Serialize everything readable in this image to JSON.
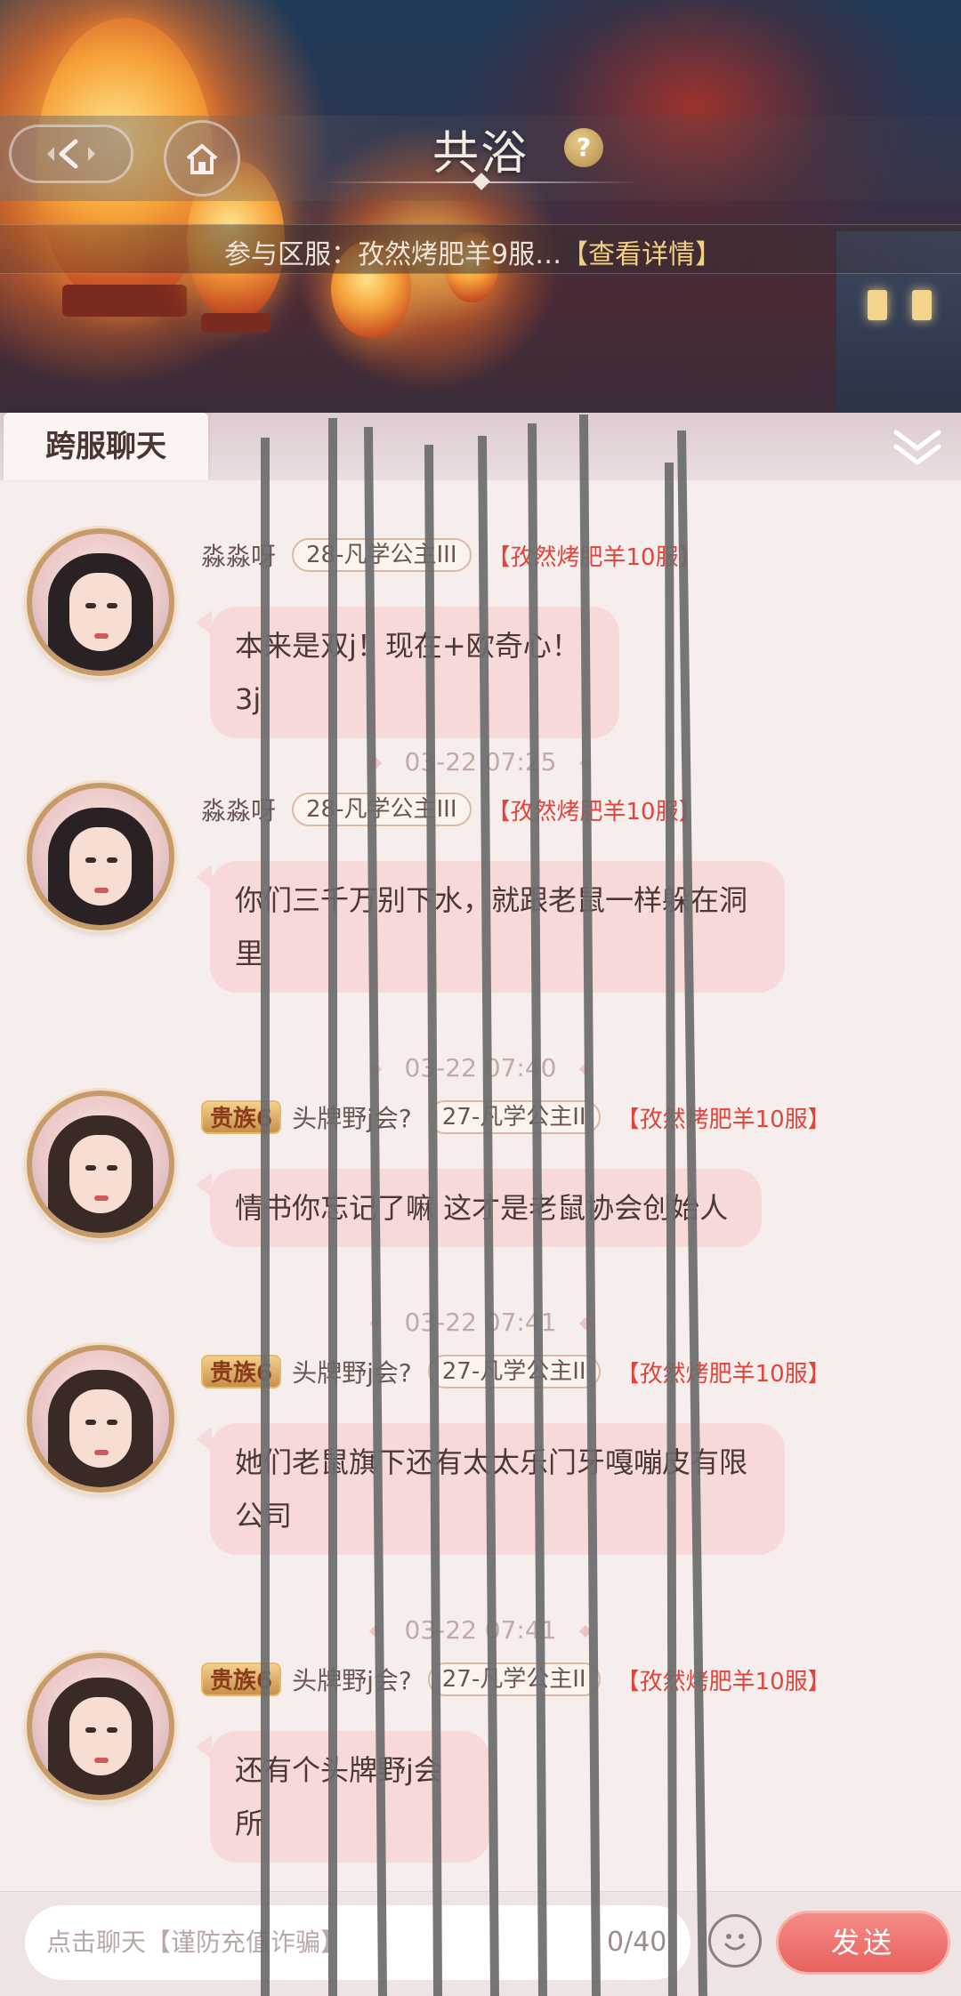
{
  "header": {
    "title": "共浴",
    "help_label": "?",
    "server_prefix": "参与区服：孜然烤肥羊9服…",
    "server_link": "【查看详情】"
  },
  "tabs": [
    {
      "label": "跨服聊天",
      "active": true
    }
  ],
  "messages": [
    {
      "name": "淼淼呀",
      "rank": "28-凡学公主III",
      "server": "【孜然烤肥羊10服】",
      "noble": "",
      "text": "本来是双j！现在+欧奇心！3j"
    },
    {
      "timestamp": "03-22 07:25",
      "name": "淼淼呀",
      "rank": "28-凡学公主III",
      "server": "【孜然烤肥羊10服】",
      "noble": "",
      "text": "你们三千万别下水，就跟老鼠一样躲在洞里"
    },
    {
      "timestamp": "03-22 07:40",
      "name": "头牌野j会?",
      "rank": "27-凡学公主II",
      "server": "【孜然烤肥羊10服】",
      "noble": "贵族6",
      "text": "情书你忘记了嘛 这才是老鼠协会创始人"
    },
    {
      "timestamp": "03-22 07:41",
      "name": "头牌野j会?",
      "rank": "27-凡学公主II",
      "server": "【孜然烤肥羊10服】",
      "noble": "贵族6",
      "text": "她们老鼠旗下还有太太乐门牙嘎嘣皮有限公司"
    },
    {
      "timestamp": "03-22 07:41",
      "name": "头牌野j会?",
      "rank": "27-凡学公主II",
      "server": "【孜然烤肥羊10服】",
      "noble": "贵族6",
      "text": "还有个头牌野j会所"
    }
  ],
  "input": {
    "placeholder": "点击聊天【谨防充值诈骗】",
    "char_count": "0/40",
    "send_label": "发送"
  },
  "icons": {
    "back": "back-arrow-icon",
    "home": "home-icon",
    "collapse": "double-chevron-down-icon",
    "emoji": "smiley-icon"
  },
  "colors": {
    "accent": "#e7625e",
    "server_tag": "#e0443a",
    "bubble": "#f7d9da"
  }
}
